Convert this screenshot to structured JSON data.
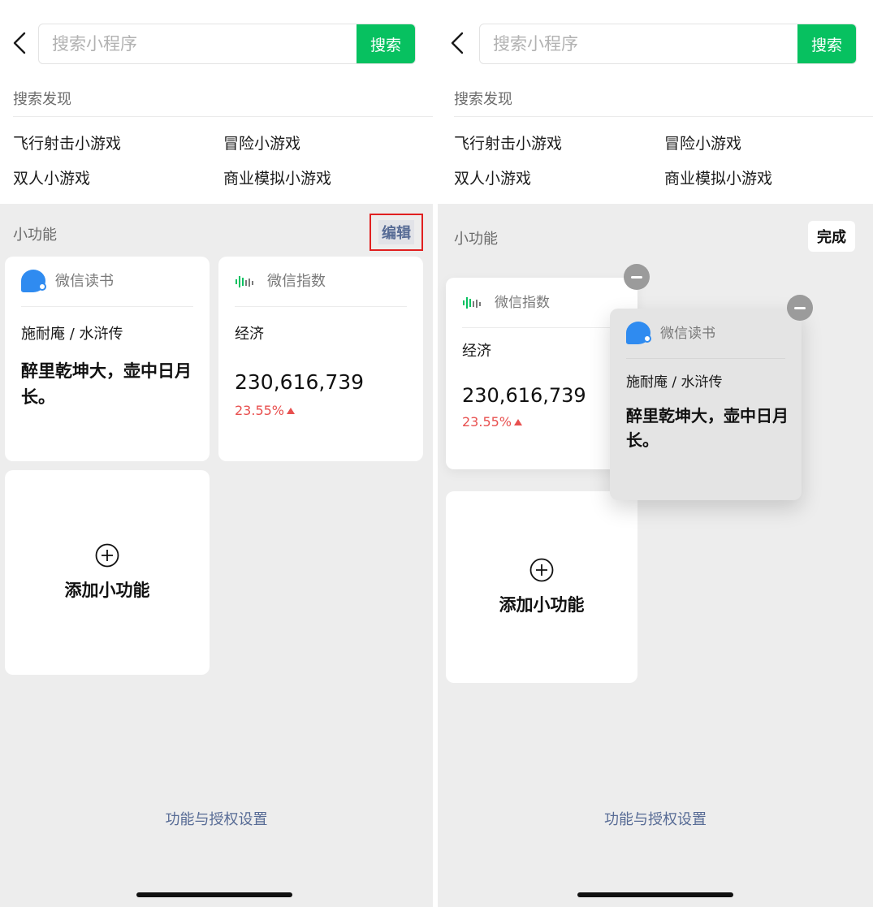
{
  "left": {
    "search": {
      "placeholder": "搜索小程序",
      "button": "搜索"
    },
    "discover": {
      "label": "搜索发现",
      "items": [
        "飞行射击小游戏",
        "冒险小游戏",
        "双人小游戏",
        "商业模拟小游戏"
      ]
    },
    "widgets": {
      "title": "小功能",
      "edit": "编辑",
      "read_card": {
        "app": "微信读书",
        "author": "施耐庵 / 水浒传",
        "quote": "醉里乾坤大，壶中日月长。"
      },
      "index_card": {
        "app": "微信指数",
        "topic": "经济",
        "value": "230,616,739",
        "change": "23.55%",
        "trend": "up"
      },
      "add_label": "添加小功能"
    },
    "settings": "功能与授权设置"
  },
  "right": {
    "search": {
      "placeholder": "搜索小程序",
      "button": "搜索"
    },
    "discover": {
      "label": "搜索发现",
      "items": [
        "飞行射击小游戏",
        "冒险小游戏",
        "双人小游戏",
        "商业模拟小游戏"
      ]
    },
    "widgets": {
      "title": "小功能",
      "done": "完成",
      "index_card": {
        "app": "微信指数",
        "topic": "经济",
        "value": "230,616,739",
        "change": "23.55%",
        "trend": "up"
      },
      "read_card": {
        "app": "微信读书",
        "author": "施耐庵 / 水浒传",
        "quote": "醉里乾坤大，壶中日月长。"
      },
      "add_label": "添加小功能"
    },
    "settings": "功能与授权设置"
  },
  "colors": {
    "accent_green": "#07c160",
    "link_blue": "#576b95",
    "up_red": "#e8504f",
    "highlight_red": "#e02020"
  }
}
